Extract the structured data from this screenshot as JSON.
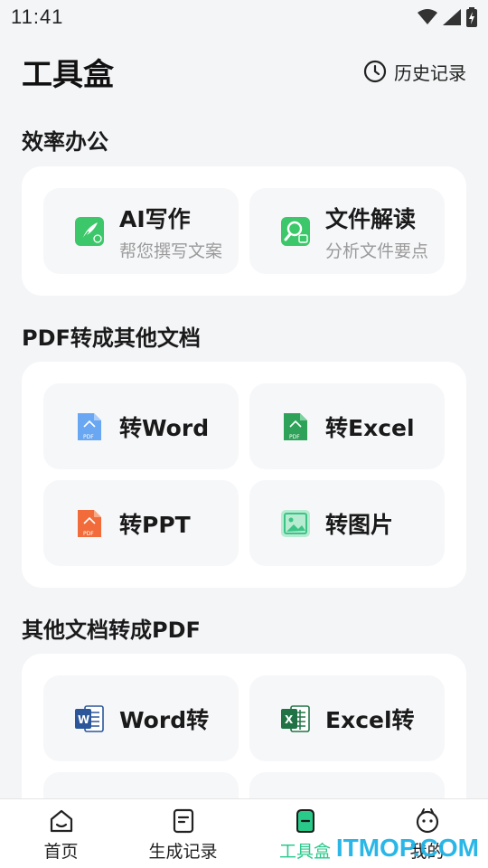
{
  "status": {
    "time": "11:41"
  },
  "header": {
    "title": "工具盒",
    "history_label": "历史记录"
  },
  "sections": [
    {
      "title": "效率办公",
      "tiles": [
        {
          "label": "AI写作",
          "sub": "帮您撰写文案",
          "icon": "ai-writing-icon"
        },
        {
          "label": "文件解读",
          "sub": "分析文件要点",
          "icon": "file-analysis-icon"
        }
      ]
    },
    {
      "title": "PDF转成其他文档",
      "tiles": [
        {
          "label": "转Word",
          "icon": "pdf-to-word-icon"
        },
        {
          "label": "转Excel",
          "icon": "pdf-to-excel-icon"
        },
        {
          "label": "转PPT",
          "icon": "pdf-to-ppt-icon"
        },
        {
          "label": "转图片",
          "icon": "pdf-to-image-icon"
        }
      ]
    },
    {
      "title": "其他文档转成PDF",
      "tiles": [
        {
          "label": "Word转",
          "icon": "word-doc-icon"
        },
        {
          "label": "Excel转",
          "icon": "excel-doc-icon"
        }
      ]
    }
  ],
  "nav": [
    {
      "label": "首页",
      "icon": "home-icon"
    },
    {
      "label": "生成记录",
      "icon": "records-icon"
    },
    {
      "label": "工具盒",
      "icon": "toolbox-icon",
      "active": true
    },
    {
      "label": "我的",
      "icon": "profile-icon"
    }
  ],
  "watermark": "ITMOP.COM",
  "colors": {
    "accent": "#29c98a",
    "background": "#f4f5f7",
    "watermark": "#1fb4e6"
  }
}
